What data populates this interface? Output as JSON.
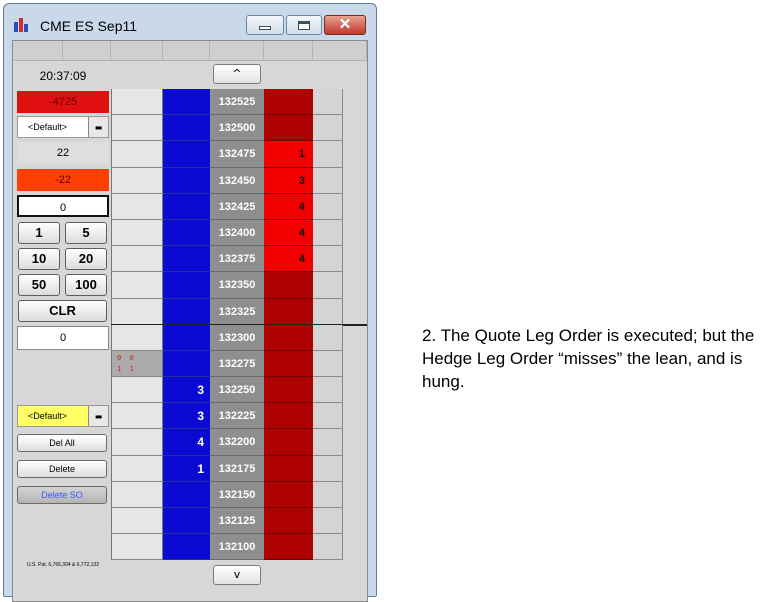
{
  "window": {
    "title": "CME ES Sep11"
  },
  "left_panel": {
    "time": "20:37:09",
    "pnl": "-4725",
    "account_dropdown": "<Default>",
    "position_count": "22",
    "position": "-22",
    "qty_input": "0",
    "qty_buttons": [
      "1",
      "5",
      "10",
      "20",
      "50",
      "100"
    ],
    "clear_label": "CLR",
    "working_qty": "0",
    "strategy_dropdown": "<Default>",
    "del_all_label": "Del All",
    "delete_label": "Delete",
    "delete_so_label": "Delete SO",
    "patent": "U.S. Pat. 6,766,304 & 6,772,132"
  },
  "scroll": {
    "up_label": "^",
    "down_label": "v"
  },
  "ladder": {
    "rows": [
      {
        "price": "132525",
        "bid": "",
        "ask": ""
      },
      {
        "price": "132500",
        "bid": "",
        "ask": ""
      },
      {
        "price": "132475",
        "bid": "",
        "ask": "1"
      },
      {
        "price": "132450",
        "bid": "",
        "ask": "3"
      },
      {
        "price": "132425",
        "bid": "",
        "ask": "4"
      },
      {
        "price": "132400",
        "bid": "",
        "ask": "4"
      },
      {
        "price": "132375",
        "bid": "",
        "ask": "4"
      },
      {
        "price": "132350",
        "bid": "",
        "ask": ""
      },
      {
        "price": "132325",
        "bid": "",
        "ask": ""
      },
      {
        "price": "132300",
        "bid": "",
        "ask": ""
      },
      {
        "price": "132275",
        "bid": "",
        "ask": "",
        "fills": "0  0\n1  1"
      },
      {
        "price": "132250",
        "bid": "3",
        "ask": ""
      },
      {
        "price": "132225",
        "bid": "3",
        "ask": ""
      },
      {
        "price": "132200",
        "bid": "4",
        "ask": ""
      },
      {
        "price": "132175",
        "bid": "1",
        "ask": ""
      },
      {
        "price": "132150",
        "bid": "",
        "ask": ""
      },
      {
        "price": "132125",
        "bid": "",
        "ask": ""
      },
      {
        "price": "132100",
        "bid": "",
        "ask": ""
      }
    ]
  },
  "caption": "2. The Quote Leg Order is executed; but the Hedge Leg Order “misses” the lean, and is hung.",
  "colors": {
    "bid": "#0a0ad2",
    "ask": "#ad0000",
    "ask_highlight": "#f20000",
    "price": "#8e8e8e",
    "pnl": "#e01010",
    "position": "#ff4000",
    "strategy": "#ffff66"
  }
}
